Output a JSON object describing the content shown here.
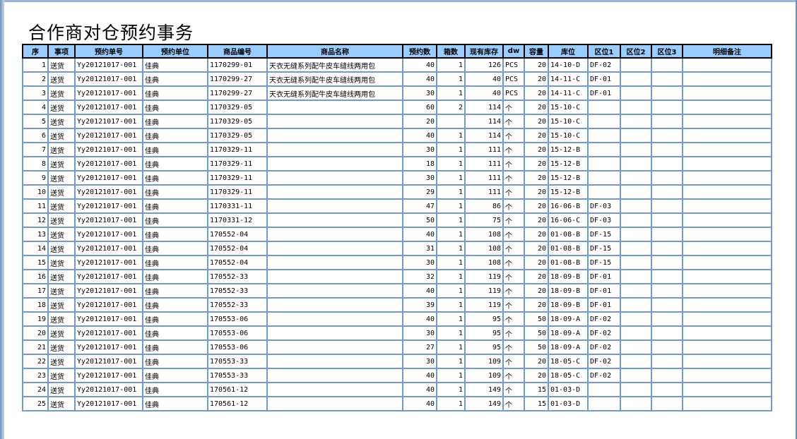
{
  "title": "合作商对仓预约事务",
  "columns": [
    "序",
    "事项",
    "预约单号",
    "预约单位",
    "商品编号",
    "商品名称",
    "预约数",
    "箱数",
    "现有库存",
    "dw",
    "容量",
    "库位",
    "区位1",
    "区位2",
    "区位3",
    "明细备注"
  ],
  "rows": [
    [
      "1",
      "送货",
      "Yy20121017-001",
      "佳典",
      "1170299-01",
      "天衣无缝系列配牛皮车缝线两用包",
      "40",
      "1",
      "126",
      "PCS",
      "20",
      "14-10-D",
      "DF-02",
      "",
      "",
      ""
    ],
    [
      "2",
      "送货",
      "Yy20121017-001",
      "佳典",
      "1170299-27",
      "天衣无缝系列配牛皮车缝线两用包",
      "40",
      "1",
      "40",
      "PCS",
      "20",
      "14-11-C",
      "DF-01",
      "",
      "",
      ""
    ],
    [
      "3",
      "送货",
      "Yy20121017-001",
      "佳典",
      "1170299-27",
      "天衣无缝系列配牛皮车缝线两用包",
      "30",
      "1",
      "40",
      "PCS",
      "20",
      "14-11-C",
      "DF-01",
      "",
      "",
      ""
    ],
    [
      "4",
      "送货",
      "Yy20121017-001",
      "佳典",
      "1170329-05",
      "",
      "60",
      "2",
      "114",
      "个",
      "20",
      "15-10-C",
      "",
      "",
      "",
      ""
    ],
    [
      "5",
      "送货",
      "Yy20121017-001",
      "佳典",
      "1170329-05",
      "",
      "20",
      "",
      "114",
      "个",
      "20",
      "15-10-C",
      "",
      "",
      "",
      ""
    ],
    [
      "6",
      "送货",
      "Yy20121017-001",
      "佳典",
      "1170329-05",
      "",
      "40",
      "1",
      "114",
      "个",
      "20",
      "15-10-C",
      "",
      "",
      "",
      ""
    ],
    [
      "7",
      "送货",
      "Yy20121017-001",
      "佳典",
      "1170329-11",
      "",
      "30",
      "1",
      "111",
      "个",
      "20",
      "15-12-B",
      "",
      "",
      "",
      ""
    ],
    [
      "8",
      "送货",
      "Yy20121017-001",
      "佳典",
      "1170329-11",
      "",
      "18",
      "1",
      "111",
      "个",
      "20",
      "15-12-B",
      "",
      "",
      "",
      ""
    ],
    [
      "9",
      "送货",
      "Yy20121017-001",
      "佳典",
      "1170329-11",
      "",
      "30",
      "1",
      "111",
      "个",
      "20",
      "15-12-B",
      "",
      "",
      "",
      ""
    ],
    [
      "10",
      "送货",
      "Yy20121017-001",
      "佳典",
      "1170329-11",
      "",
      "29",
      "1",
      "111",
      "个",
      "20",
      "15-12-B",
      "",
      "",
      "",
      ""
    ],
    [
      "11",
      "送货",
      "Yy20121017-001",
      "佳典",
      "1170331-11",
      "",
      "47",
      "1",
      "86",
      "个",
      "20",
      "16-06-B",
      "DF-03",
      "",
      "",
      ""
    ],
    [
      "12",
      "送货",
      "Yy20121017-001",
      "佳典",
      "1170331-12",
      "",
      "50",
      "1",
      "75",
      "个",
      "20",
      "16-06-C",
      "DF-03",
      "",
      "",
      ""
    ],
    [
      "13",
      "送货",
      "Yy20121017-001",
      "佳典",
      "170552-04",
      "",
      "40",
      "1",
      "108",
      "个",
      "20",
      "01-08-B",
      "DF-15",
      "",
      "",
      ""
    ],
    [
      "14",
      "送货",
      "Yy20121017-001",
      "佳典",
      "170552-04",
      "",
      "31",
      "1",
      "108",
      "个",
      "20",
      "01-08-B",
      "DF-15",
      "",
      "",
      ""
    ],
    [
      "15",
      "送货",
      "Yy20121017-001",
      "佳典",
      "170552-04",
      "",
      "30",
      "1",
      "108",
      "个",
      "20",
      "01-08-B",
      "DF-15",
      "",
      "",
      ""
    ],
    [
      "16",
      "送货",
      "Yy20121017-001",
      "佳典",
      "170552-33",
      "",
      "32",
      "1",
      "119",
      "个",
      "20",
      "18-09-B",
      "DF-01",
      "",
      "",
      ""
    ],
    [
      "17",
      "送货",
      "Yy20121017-001",
      "佳典",
      "170552-33",
      "",
      "40",
      "1",
      "119",
      "个",
      "20",
      "18-09-B",
      "DF-01",
      "",
      "",
      ""
    ],
    [
      "18",
      "送货",
      "Yy20121017-001",
      "佳典",
      "170552-33",
      "",
      "39",
      "1",
      "119",
      "个",
      "20",
      "18-09-B",
      "DF-01",
      "",
      "",
      ""
    ],
    [
      "19",
      "送货",
      "Yy20121017-001",
      "佳典",
      "170553-06",
      "",
      "40",
      "1",
      "95",
      "个",
      "50",
      "18-09-A",
      "DF-02",
      "",
      "",
      ""
    ],
    [
      "20",
      "送货",
      "Yy20121017-001",
      "佳典",
      "170553-06",
      "",
      "30",
      "1",
      "95",
      "个",
      "50",
      "18-09-A",
      "DF-02",
      "",
      "",
      ""
    ],
    [
      "21",
      "送货",
      "Yy20121017-001",
      "佳典",
      "170553-06",
      "",
      "27",
      "1",
      "95",
      "个",
      "50",
      "18-09-A",
      "DF-02",
      "",
      "",
      ""
    ],
    [
      "22",
      "送货",
      "Yy20121017-001",
      "佳典",
      "170553-33",
      "",
      "30",
      "1",
      "109",
      "个",
      "20",
      "18-05-C",
      "DF-02",
      "",
      "",
      ""
    ],
    [
      "23",
      "送货",
      "Yy20121017-001",
      "佳典",
      "170553-33",
      "",
      "40",
      "1",
      "109",
      "个",
      "20",
      "18-05-C",
      "DF-02",
      "",
      "",
      ""
    ],
    [
      "24",
      "送货",
      "Yy20121017-001",
      "佳典",
      "170561-12",
      "",
      "40",
      "1",
      "149",
      "个",
      "15",
      "01-03-D",
      "",
      "",
      "",
      ""
    ],
    [
      "25",
      "送货",
      "Yy20121017-001",
      "佳典",
      "170561-12",
      "",
      "40",
      "1",
      "149",
      "个",
      "15",
      "01-03-D",
      "",
      "",
      "",
      ""
    ]
  ],
  "colors": {
    "header_bg": "#99ccff",
    "grid_line": "#6f9ad6"
  }
}
